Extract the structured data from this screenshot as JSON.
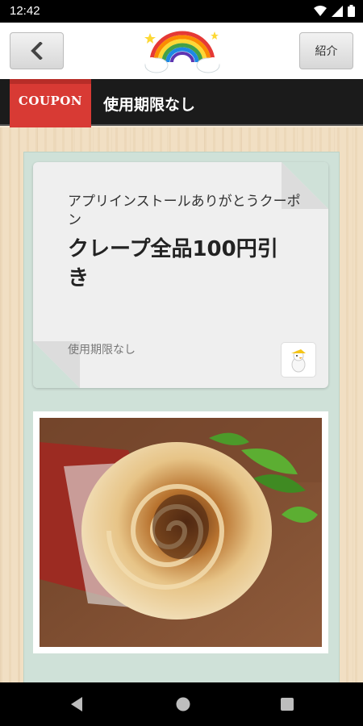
{
  "status_bar": {
    "time": "12:42",
    "icons": [
      "wifi-icon",
      "signal-icon",
      "battery-icon"
    ]
  },
  "header": {
    "back_icon": "chevron-left-icon",
    "intro_label": "紹介",
    "logo": "rainbow-logo"
  },
  "coupon_bar": {
    "badge_label": "COUPON",
    "title": "使用期限なし"
  },
  "coupon": {
    "subtitle": "アプリインストールありがとうクーポン",
    "headline": "クレープ全品100円引き",
    "expiry": "使用期限なし",
    "shop_icon": "shop-mascot-icon"
  },
  "photo": {
    "subject": "crepe-photo"
  },
  "nav": {
    "icons": [
      "nav-back-icon",
      "nav-home-icon",
      "nav-recents-icon"
    ]
  },
  "colors": {
    "banner_red": "#d83a34",
    "panel_mint": "#cfe1d8",
    "wood": "#f1dfc3",
    "header_black": "#1b1b1b"
  }
}
